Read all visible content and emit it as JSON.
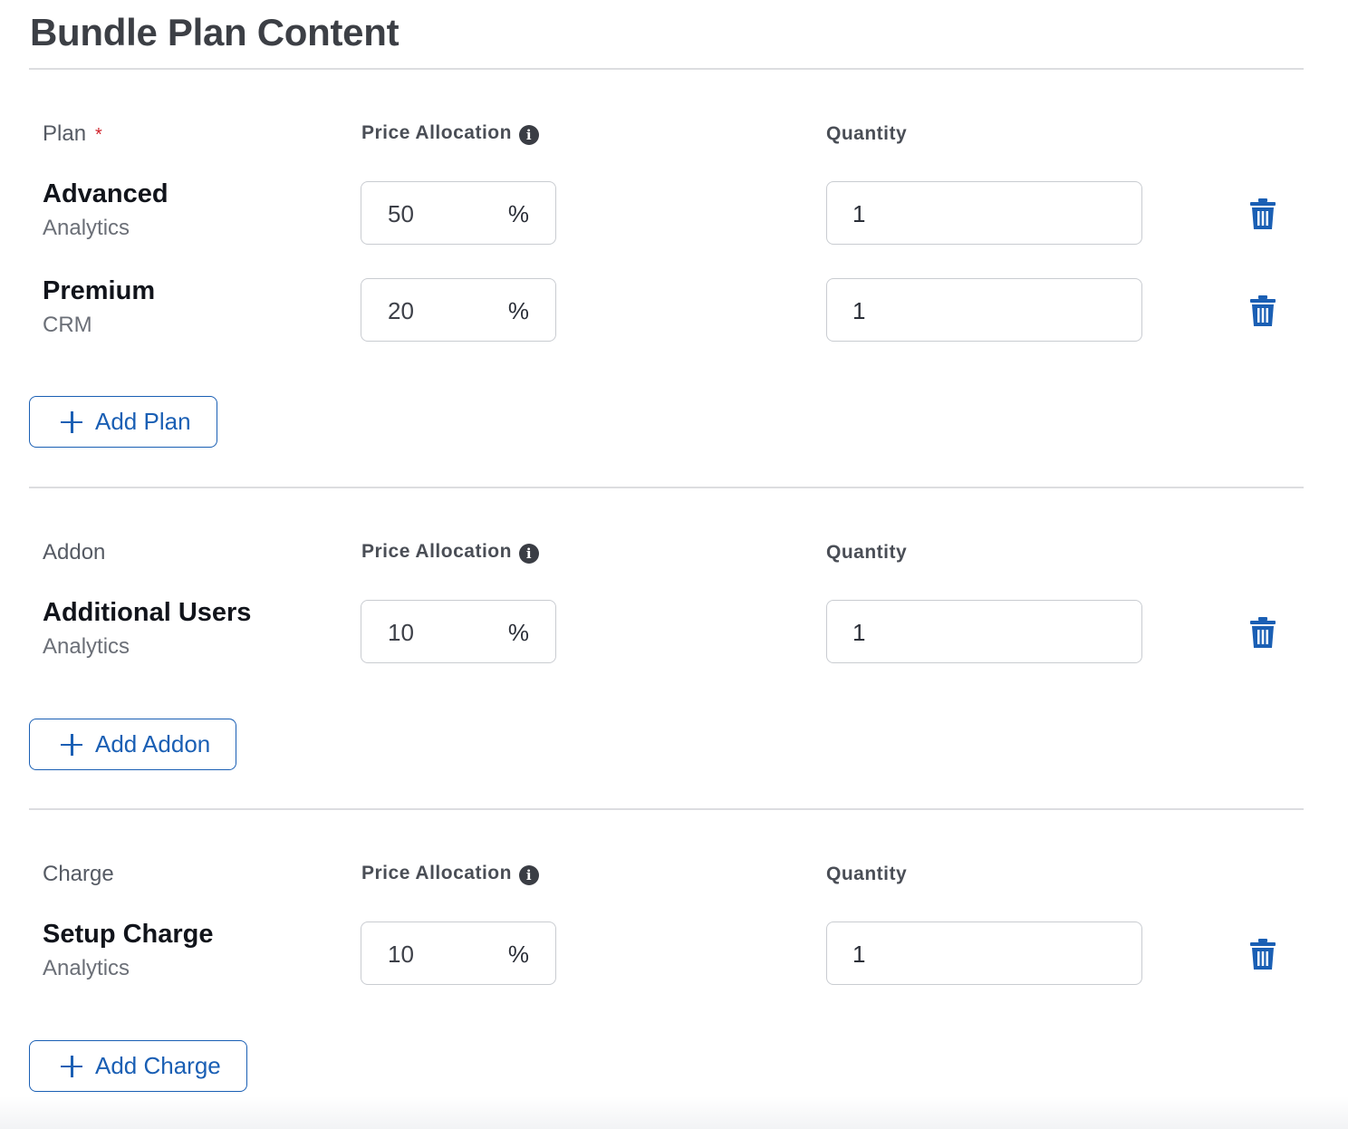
{
  "page": {
    "title": "Bundle Plan Content"
  },
  "colors": {
    "accent": "#1a5fb4",
    "required": "#d0232b",
    "border": "#c9ccd1"
  },
  "plan_section": {
    "label": "Plan",
    "required_mark": "*",
    "price_header": "Price Allocation",
    "info_icon": "i",
    "qty_header": "Quantity",
    "items": [
      {
        "name": "Advanced",
        "sub": "Analytics",
        "price": "50",
        "unit": "%",
        "qty": "1"
      },
      {
        "name": "Premium",
        "sub": "CRM",
        "price": "20",
        "unit": "%",
        "qty": "1"
      }
    ],
    "add_label": "Add Plan"
  },
  "addon_section": {
    "label": "Addon",
    "price_header": "Price Allocation",
    "info_icon": "i",
    "qty_header": "Quantity",
    "items": [
      {
        "name": "Additional Users",
        "sub": "Analytics",
        "price": "10",
        "unit": "%",
        "qty": "1"
      }
    ],
    "add_label": "Add Addon"
  },
  "charge_section": {
    "label": "Charge",
    "price_header": "Price Allocation",
    "info_icon": "i",
    "qty_header": "Quantity",
    "items": [
      {
        "name": "Setup Charge",
        "sub": "Analytics",
        "price": "10",
        "unit": "%",
        "qty": "1"
      }
    ],
    "add_label": "Add Charge"
  },
  "icons": {
    "delete": "trash-icon",
    "add": "plus-icon",
    "info": "info-icon"
  }
}
